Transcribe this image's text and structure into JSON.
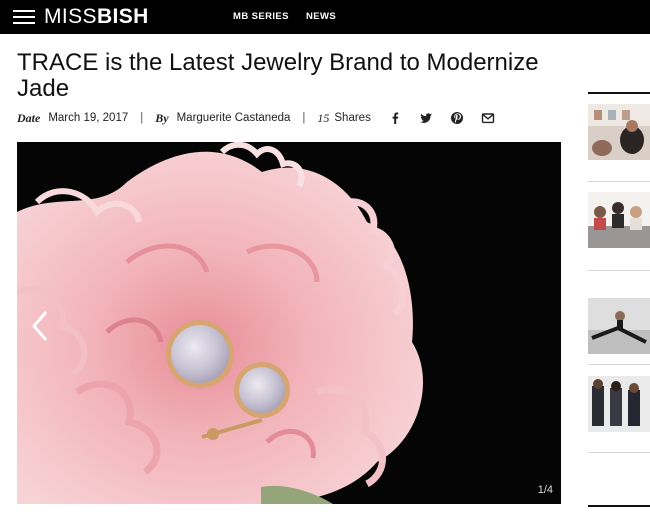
{
  "site": {
    "logo_part1": "MISS",
    "logo_part2": "BISH",
    "nav": [
      "MB SERIES",
      "NEWS"
    ]
  },
  "article": {
    "title": "TRACE is the Latest Jewelry Brand to Modernize Jade",
    "date_label": "Date",
    "date": "March 19, 2017",
    "by_label": "By",
    "author": "Marguerite Castaneda",
    "separator": "|",
    "share_count": "15",
    "share_label": "Shares",
    "share_icons": [
      "facebook-icon",
      "twitter-icon",
      "pinterest-icon",
      "email-icon"
    ]
  },
  "gallery": {
    "counter": "1/4",
    "prev_icon": "chevron-left-icon"
  },
  "colors": {
    "nav_bg": "#000000",
    "hero_bg": "#050505",
    "petal_pink": "#f2b9be"
  }
}
